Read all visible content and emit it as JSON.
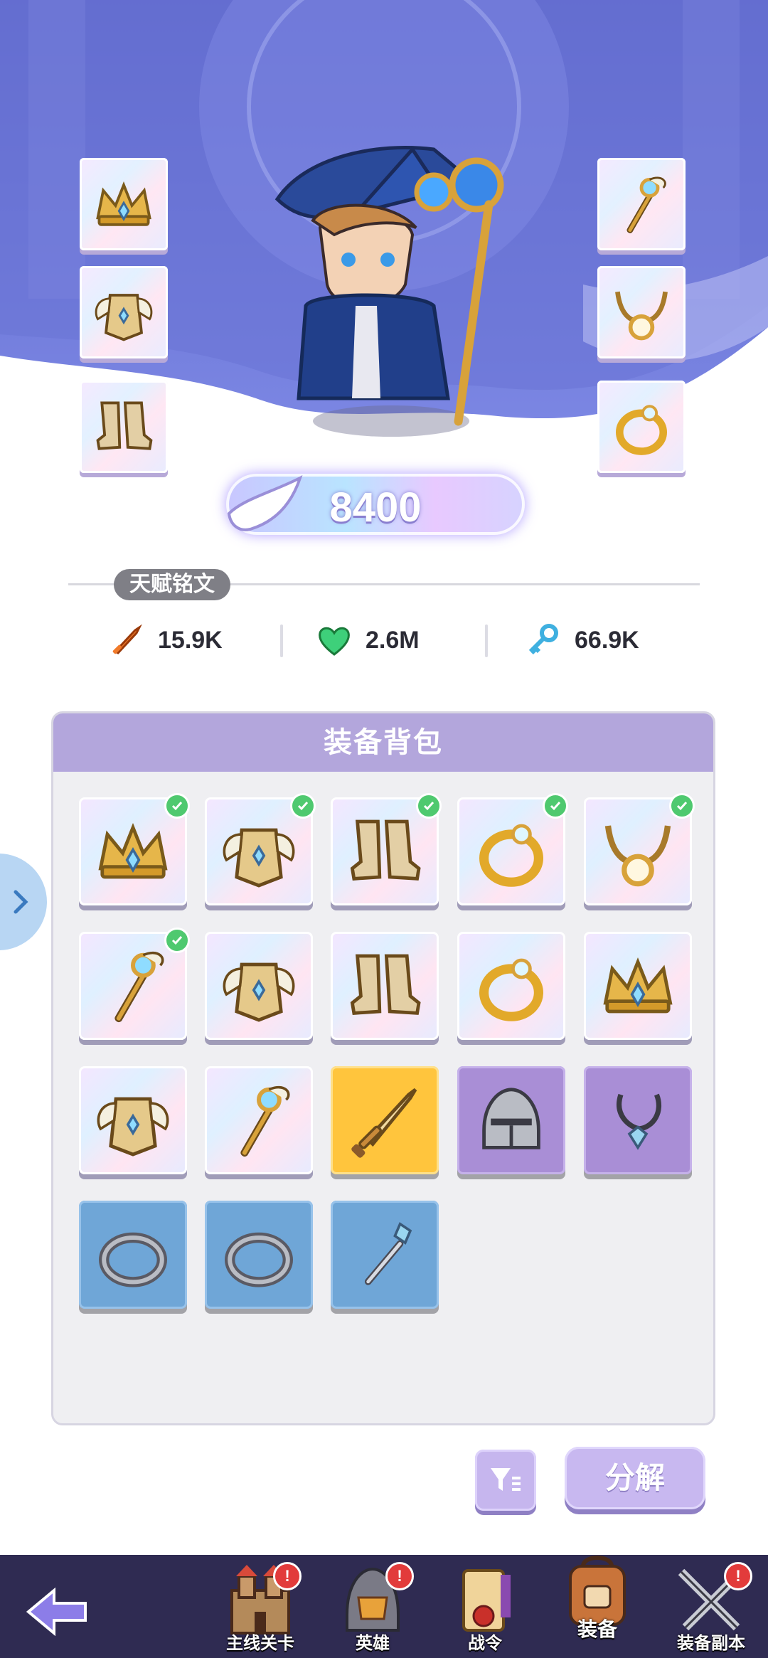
{
  "hero": {
    "power_value": "8400",
    "equipped_left": [
      {
        "name": "crown-icon"
      },
      {
        "name": "winged-armor-icon"
      },
      {
        "name": "boots-icon"
      }
    ],
    "equipped_right": [
      {
        "name": "staff-icon"
      },
      {
        "name": "necklace-icon"
      },
      {
        "name": "ring-icon"
      }
    ]
  },
  "talent": {
    "label": "天赋铭文",
    "stats": [
      {
        "icon": "sword-icon",
        "value": "15.9K",
        "color": "#f07a2a"
      },
      {
        "icon": "heart-icon",
        "value": "2.6M",
        "color": "#3ed07a"
      },
      {
        "icon": "key-icon",
        "value": "66.9K",
        "color": "#3fb0e0"
      }
    ]
  },
  "bag": {
    "title": "装备背包",
    "items": [
      {
        "icon": "crown-icon",
        "rarity": "legend",
        "equipped": true
      },
      {
        "icon": "winged-armor-icon",
        "rarity": "legend",
        "equipped": true
      },
      {
        "icon": "boots-icon",
        "rarity": "legend",
        "equipped": true
      },
      {
        "icon": "ring-icon",
        "rarity": "legend",
        "equipped": true
      },
      {
        "icon": "necklace-icon",
        "rarity": "legend",
        "equipped": true
      },
      {
        "icon": "staff-icon",
        "rarity": "legend",
        "equipped": true
      },
      {
        "icon": "winged-armor-icon",
        "rarity": "legend",
        "equipped": false
      },
      {
        "icon": "boots-icon",
        "rarity": "legend",
        "equipped": false
      },
      {
        "icon": "ring-icon",
        "rarity": "legend",
        "equipped": false
      },
      {
        "icon": "crown-icon",
        "rarity": "legend",
        "equipped": false
      },
      {
        "icon": "winged-armor-icon",
        "rarity": "legend",
        "equipped": false
      },
      {
        "icon": "staff-icon",
        "rarity": "legend",
        "equipped": false
      },
      {
        "icon": "sword-icon",
        "rarity": "gold",
        "equipped": false
      },
      {
        "icon": "helmet-icon",
        "rarity": "purple",
        "equipped": false
      },
      {
        "icon": "pendant-icon",
        "rarity": "purple",
        "equipped": false
      },
      {
        "icon": "iron-ring-icon",
        "rarity": "blue",
        "equipped": false
      },
      {
        "icon": "iron-ring-icon",
        "rarity": "blue",
        "equipped": false
      },
      {
        "icon": "wand-icon",
        "rarity": "blue",
        "equipped": false
      }
    ]
  },
  "actions": {
    "decompose_label": "分解"
  },
  "nav": {
    "items": [
      {
        "label": "主线关卡",
        "icon": "castle-icon",
        "badge": "!"
      },
      {
        "label": "英雄",
        "icon": "hero-helmet-icon",
        "badge": "!"
      },
      {
        "label": "战令",
        "icon": "scroll-icon",
        "badge": ""
      },
      {
        "label": "装备",
        "icon": "backpack-icon",
        "badge": ""
      },
      {
        "label": "装备副本",
        "icon": "crossed-swords-icon",
        "badge": "!"
      }
    ]
  }
}
